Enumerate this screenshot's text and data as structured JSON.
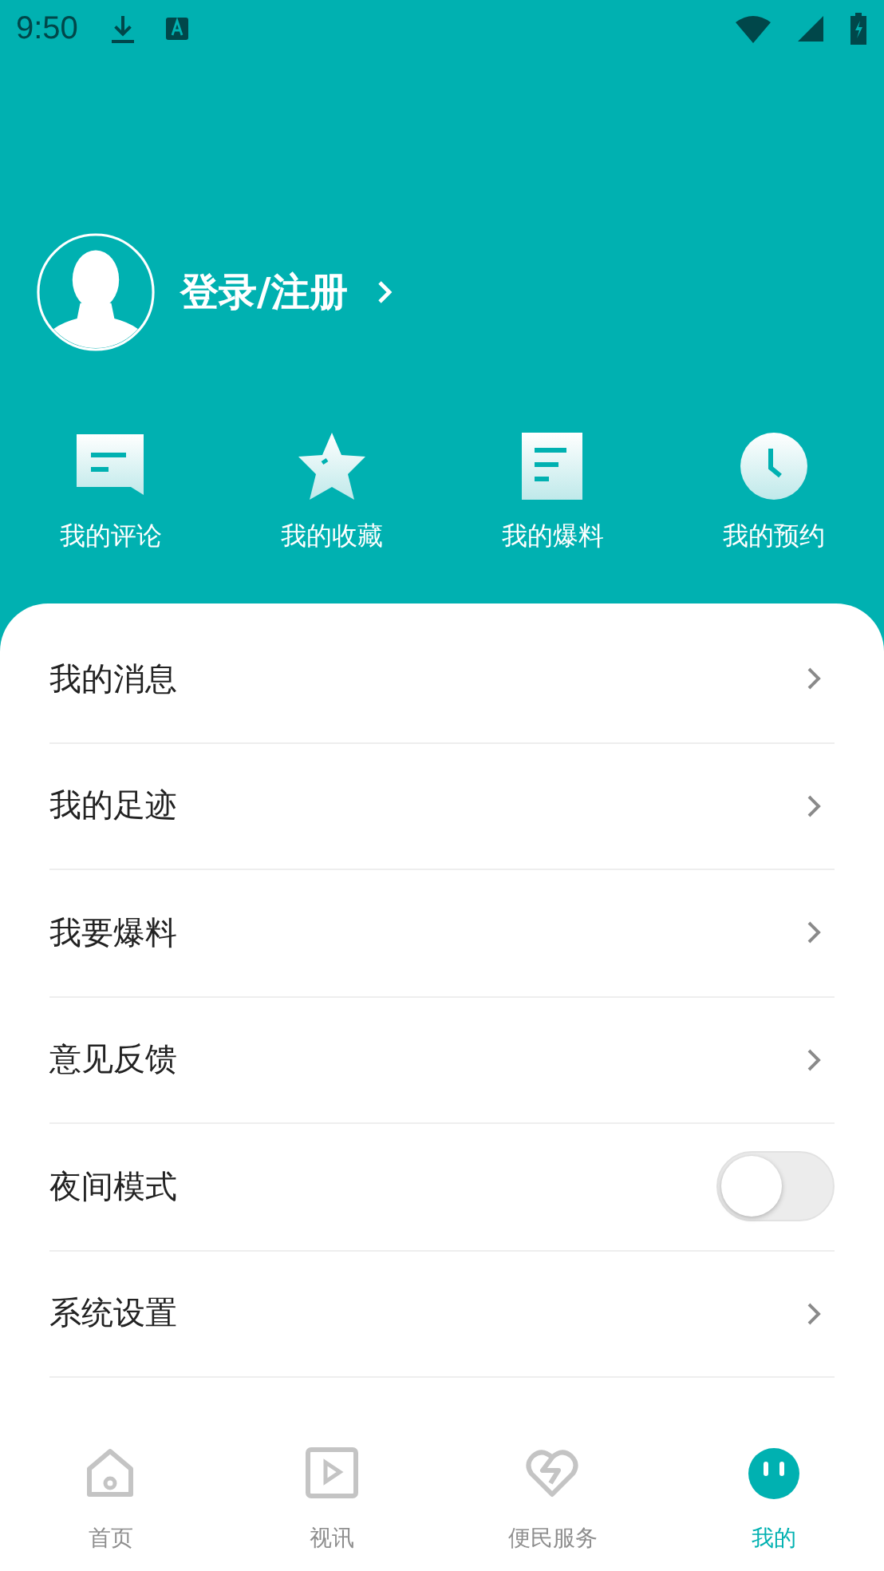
{
  "status_bar": {
    "time": "9:50"
  },
  "profile": {
    "login_label": "登录/注册"
  },
  "shortcuts": [
    {
      "kind": "comment",
      "label": "我的评论"
    },
    {
      "kind": "star",
      "label": "我的收藏"
    },
    {
      "kind": "doc",
      "label": "我的爆料"
    },
    {
      "kind": "clock",
      "label": "我的预约"
    }
  ],
  "menu": [
    {
      "kind": "link",
      "label": "我的消息"
    },
    {
      "kind": "link",
      "label": "我的足迹"
    },
    {
      "kind": "link",
      "label": "我要爆料"
    },
    {
      "kind": "link",
      "label": "意见反馈"
    },
    {
      "kind": "toggle",
      "label": "夜间模式",
      "on": false
    },
    {
      "kind": "link",
      "label": "系统设置"
    }
  ],
  "bottom_nav": [
    {
      "kind": "home",
      "label": "首页",
      "selected": false
    },
    {
      "kind": "video",
      "label": "视讯",
      "selected": false
    },
    {
      "kind": "heart",
      "label": "便民服务",
      "selected": false
    },
    {
      "kind": "me",
      "label": "我的",
      "selected": true
    }
  ]
}
